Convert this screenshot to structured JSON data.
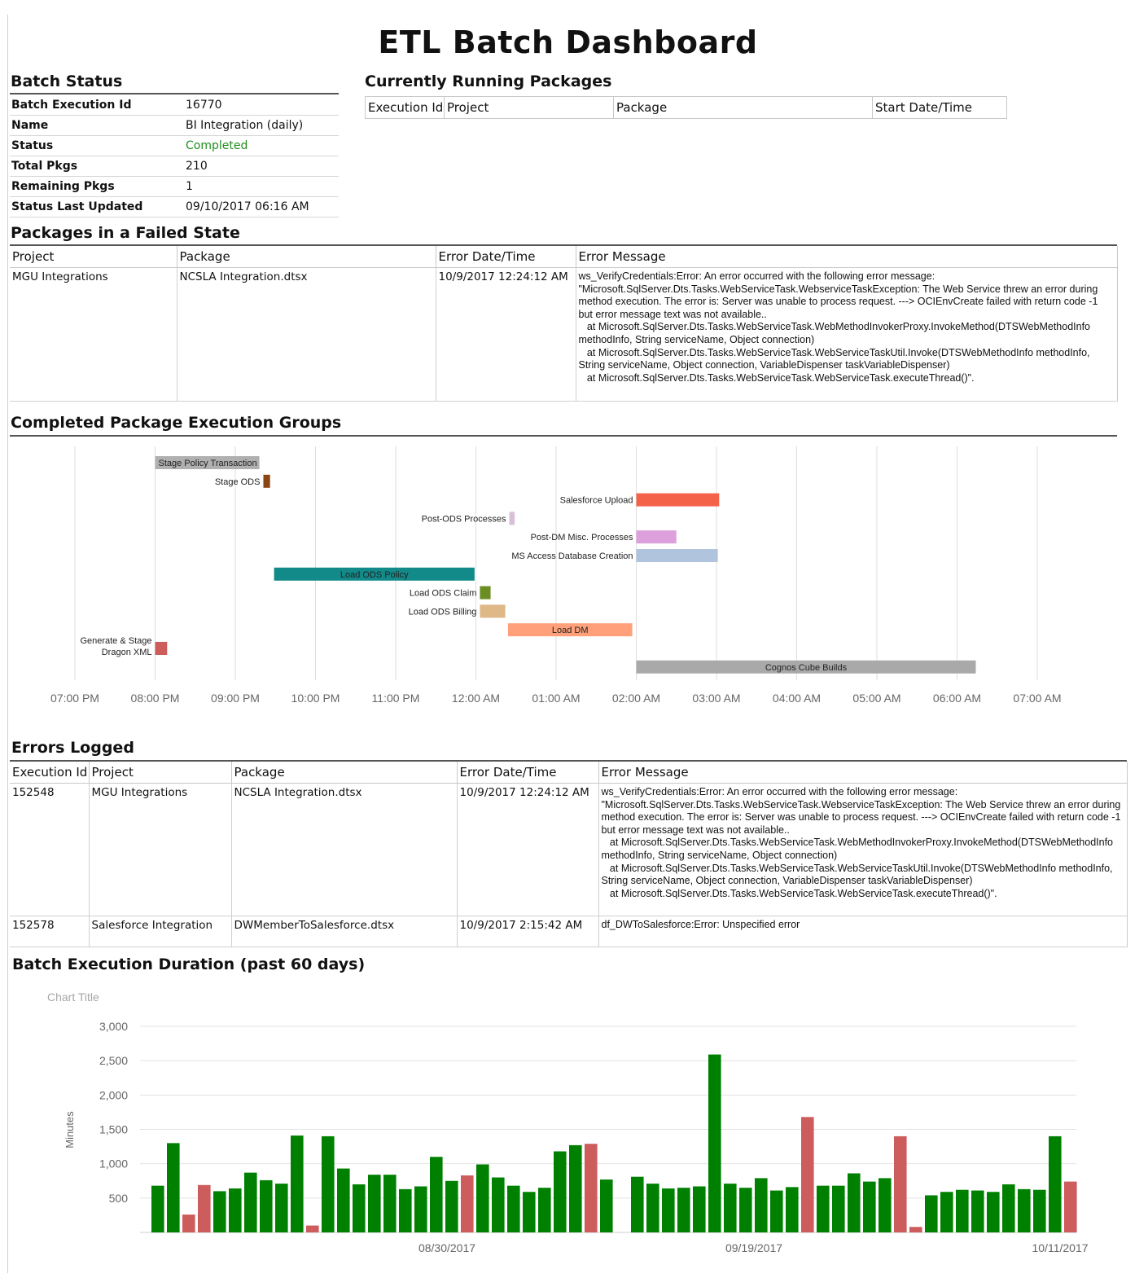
{
  "title": "ETL Batch Dashboard",
  "batch_status": {
    "title": "Batch Status",
    "rows": [
      {
        "label": "Batch Execution Id",
        "value": "16770"
      },
      {
        "label": "Name",
        "value": "BI Integration (daily)"
      },
      {
        "label": "Status",
        "value": "Completed"
      },
      {
        "label": "Total Pkgs",
        "value": "210"
      },
      {
        "label": "Remaining Pkgs",
        "value": "1"
      },
      {
        "label": "Status Last Updated",
        "value": "09/10/2017 06:16 AM"
      }
    ]
  },
  "running": {
    "title": "Currently Running Packages",
    "columns": [
      "Execution Id",
      "Project",
      "Package",
      "Start Date/Time"
    ]
  },
  "failed": {
    "title": "Packages in a Failed State",
    "columns": [
      "Project",
      "Package",
      "Error Date/Time",
      "Error Message"
    ],
    "rows": [
      {
        "project": "MGU Integrations",
        "package": "NCSLA Integration.dtsx",
        "date": "10/9/2017 12:24:12 AM",
        "message": "ws_VerifyCredentials:Error: An error occurred with the following error message: \"Microsoft.SqlServer.Dts.Tasks.WebServiceTask.WebserviceTaskException: The Web Service threw an error during method execution. The error is: Server was unable to process request. ---> OCIEnvCreate failed with return code -1 but error message text was not available..\n   at Microsoft.SqlServer.Dts.Tasks.WebServiceTask.WebMethodInvokerProxy.InvokeMethod(DTSWebMethodInfo methodInfo, String serviceName, Object connection)\n   at Microsoft.SqlServer.Dts.Tasks.WebServiceTask.WebServiceTaskUtil.Invoke(DTSWebMethodInfo methodInfo, String serviceName, Object connection, VariableDispenser taskVariableDispenser)\n   at Microsoft.SqlServer.Dts.Tasks.WebServiceTask.WebServiceTask.executeThread()\"."
      }
    ]
  },
  "groups": {
    "title": "Completed Package Execution Groups",
    "time_ticks": [
      "07:00 PM",
      "08:00 PM",
      "09:00 PM",
      "10:00 PM",
      "11:00 PM",
      "12:00 AM",
      "01:00 AM",
      "02:00 AM",
      "03:00 AM",
      "04:00 AM",
      "05:00 AM",
      "06:00 AM",
      "07:00 AM"
    ],
    "bars": [
      {
        "label": "Stage Policy Transaction",
        "start": "08:00 PM",
        "end": "09:18 PM",
        "color": "#b0b0b0",
        "label_inside": true
      },
      {
        "label": "Stage ODS",
        "start": "09:21 PM",
        "end": "09:26 PM",
        "color": "#8b4513",
        "label_inside": false
      },
      {
        "label": "Salesforce Upload",
        "start": "02:00 AM",
        "end": "03:02 AM",
        "color": "#f4624a",
        "label_inside": false
      },
      {
        "label": "Post-ODS Processes",
        "start": "12:25 AM",
        "end": "12:29 AM",
        "color": "#d8bfd8",
        "label_inside": false
      },
      {
        "label": "Post-DM Misc. Processes",
        "start": "02:00 AM",
        "end": "02:30 AM",
        "color": "#dda0dd",
        "label_inside": false
      },
      {
        "label": "MS Access Database Creation",
        "start": "02:00 AM",
        "end": "03:01 AM",
        "color": "#b0c4de",
        "label_inside": false
      },
      {
        "label": "Load ODS Policy",
        "start": "09:29 PM",
        "end": "11:59 PM",
        "color": "#138a8a",
        "label_inside": true
      },
      {
        "label": "Load ODS Claim",
        "start": "12:03 AM",
        "end": "12:11 AM",
        "color": "#6b8e23",
        "label_inside": false
      },
      {
        "label": "Load ODS Billing",
        "start": "12:03 AM",
        "end": "12:22 AM",
        "color": "#deb887",
        "label_inside": false
      },
      {
        "label": "Load DM",
        "start": "12:24 AM",
        "end": "01:57 AM",
        "color": "#ffa07a",
        "label_inside": true
      },
      {
        "label": "Generate & Stage Dragon XML",
        "start": "08:00 PM",
        "end": "08:09 PM",
        "color": "#cd5c5c",
        "label_inside": false
      },
      {
        "label": "Cognos Cube Builds",
        "start": "02:00 AM",
        "end": "06:14 AM",
        "color": "#a9a9a9",
        "label_inside": true
      }
    ]
  },
  "errors": {
    "title": "Errors Logged",
    "columns": [
      "Execution Id",
      "Project",
      "Package",
      "Error Date/Time",
      "Error Message"
    ],
    "rows": [
      {
        "id": "152548",
        "project": "MGU Integrations",
        "package": "NCSLA Integration.dtsx",
        "date": "10/9/2017 12:24:12 AM",
        "message": "ws_VerifyCredentials:Error: An error occurred with the following error message: \"Microsoft.SqlServer.Dts.Tasks.WebServiceTask.WebserviceTaskException: The Web Service threw an error during method execution. The error is: Server was unable to process request. ---> OCIEnvCreate failed with return code -1 but error message text was not available..\n   at Microsoft.SqlServer.Dts.Tasks.WebServiceTask.WebMethodInvokerProxy.InvokeMethod(DTSWebMethodInfo methodInfo, String serviceName, Object connection)\n   at Microsoft.SqlServer.Dts.Tasks.WebServiceTask.WebServiceTaskUtil.Invoke(DTSWebMethodInfo methodInfo, String serviceName, Object connection, VariableDispenser taskVariableDispenser)\n   at Microsoft.SqlServer.Dts.Tasks.WebServiceTask.WebServiceTask.executeThread()\"."
      },
      {
        "id": "152578",
        "project": "Salesforce Integration",
        "package": "DWMemberToSalesforce.dtsx",
        "date": "10/9/2017 2:15:42 AM",
        "message": "df_DWToSalesforce:Error: Unspecified error"
      }
    ]
  },
  "duration": {
    "title": "Batch Execution Duration (past 60 days)"
  },
  "chart_data": {
    "type": "bar",
    "title": "Chart Title",
    "ylabel": "Minutes",
    "ylim": [
      0,
      3000
    ],
    "yticks": [
      500,
      1000,
      1500,
      2000,
      2500,
      3000
    ],
    "x_tick_labels": [
      "08/30/2017",
      "09/19/2017",
      "10/11/2017"
    ],
    "grid": true,
    "colors": {
      "completed": "#008000",
      "failed": "#cd5c5c"
    },
    "values": [
      680,
      1300,
      260,
      690,
      600,
      640,
      870,
      760,
      710,
      1410,
      100,
      1400,
      930,
      700,
      840,
      840,
      630,
      670,
      1100,
      750,
      830,
      990,
      800,
      680,
      590,
      650,
      1180,
      1270,
      1290,
      770,
      0,
      810,
      710,
      640,
      650,
      670,
      2590,
      710,
      650,
      790,
      610,
      660,
      1680,
      680,
      680,
      860,
      740,
      790,
      1400,
      80,
      540,
      590,
      620,
      610,
      590,
      700,
      630,
      620,
      1400,
      740
    ],
    "status": [
      "ok",
      "ok",
      "fail",
      "fail",
      "ok",
      "ok",
      "ok",
      "ok",
      "ok",
      "ok",
      "fail",
      "ok",
      "ok",
      "ok",
      "ok",
      "ok",
      "ok",
      "ok",
      "ok",
      "ok",
      "fail",
      "ok",
      "ok",
      "ok",
      "ok",
      "ok",
      "ok",
      "ok",
      "fail",
      "ok",
      "ok",
      "ok",
      "ok",
      "ok",
      "ok",
      "ok",
      "ok",
      "ok",
      "ok",
      "ok",
      "ok",
      "ok",
      "fail",
      "ok",
      "ok",
      "ok",
      "ok",
      "ok",
      "fail",
      "fail",
      "ok",
      "ok",
      "ok",
      "ok",
      "ok",
      "ok",
      "ok",
      "ok",
      "ok",
      "fail"
    ]
  }
}
